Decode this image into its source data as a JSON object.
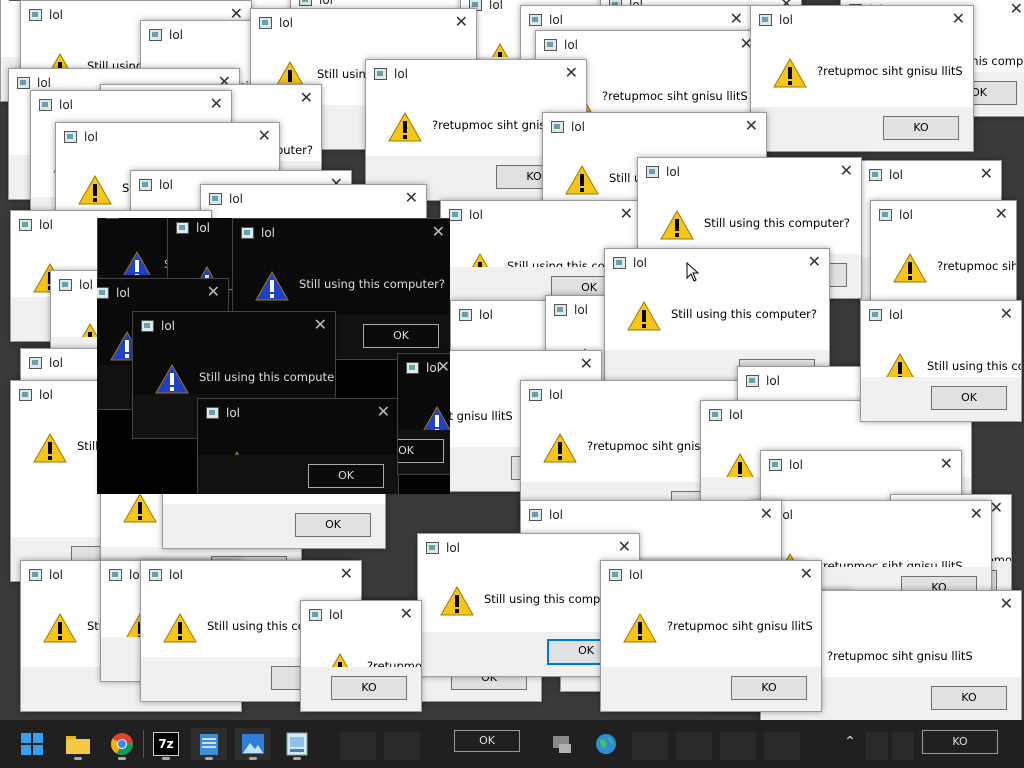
{
  "dialog_title": "lol",
  "message_normal": "Still using this computer?",
  "message_mirrored": "?retupmoc siht gnisu llitS",
  "button_ok": "OK",
  "button_mirrored": "KO",
  "close_glyph": "✕",
  "icons": {
    "warning": "warning-icon",
    "app": "app-icon",
    "close": "close-icon"
  },
  "colors": {
    "warning_yellow": "#f5c518",
    "dark_warning_blue": "#2140c8",
    "button_focus": "#0078d7"
  },
  "taskbar": {
    "items": [
      "start",
      "file-explorer",
      "chrome",
      "7zip",
      "notepad",
      "photos",
      "paint",
      "network-share",
      "edge-globe"
    ],
    "sevenzip_label": "7z",
    "tray_chevron": "⌃",
    "tray_ok": "OK",
    "tray_ko": "KO"
  }
}
